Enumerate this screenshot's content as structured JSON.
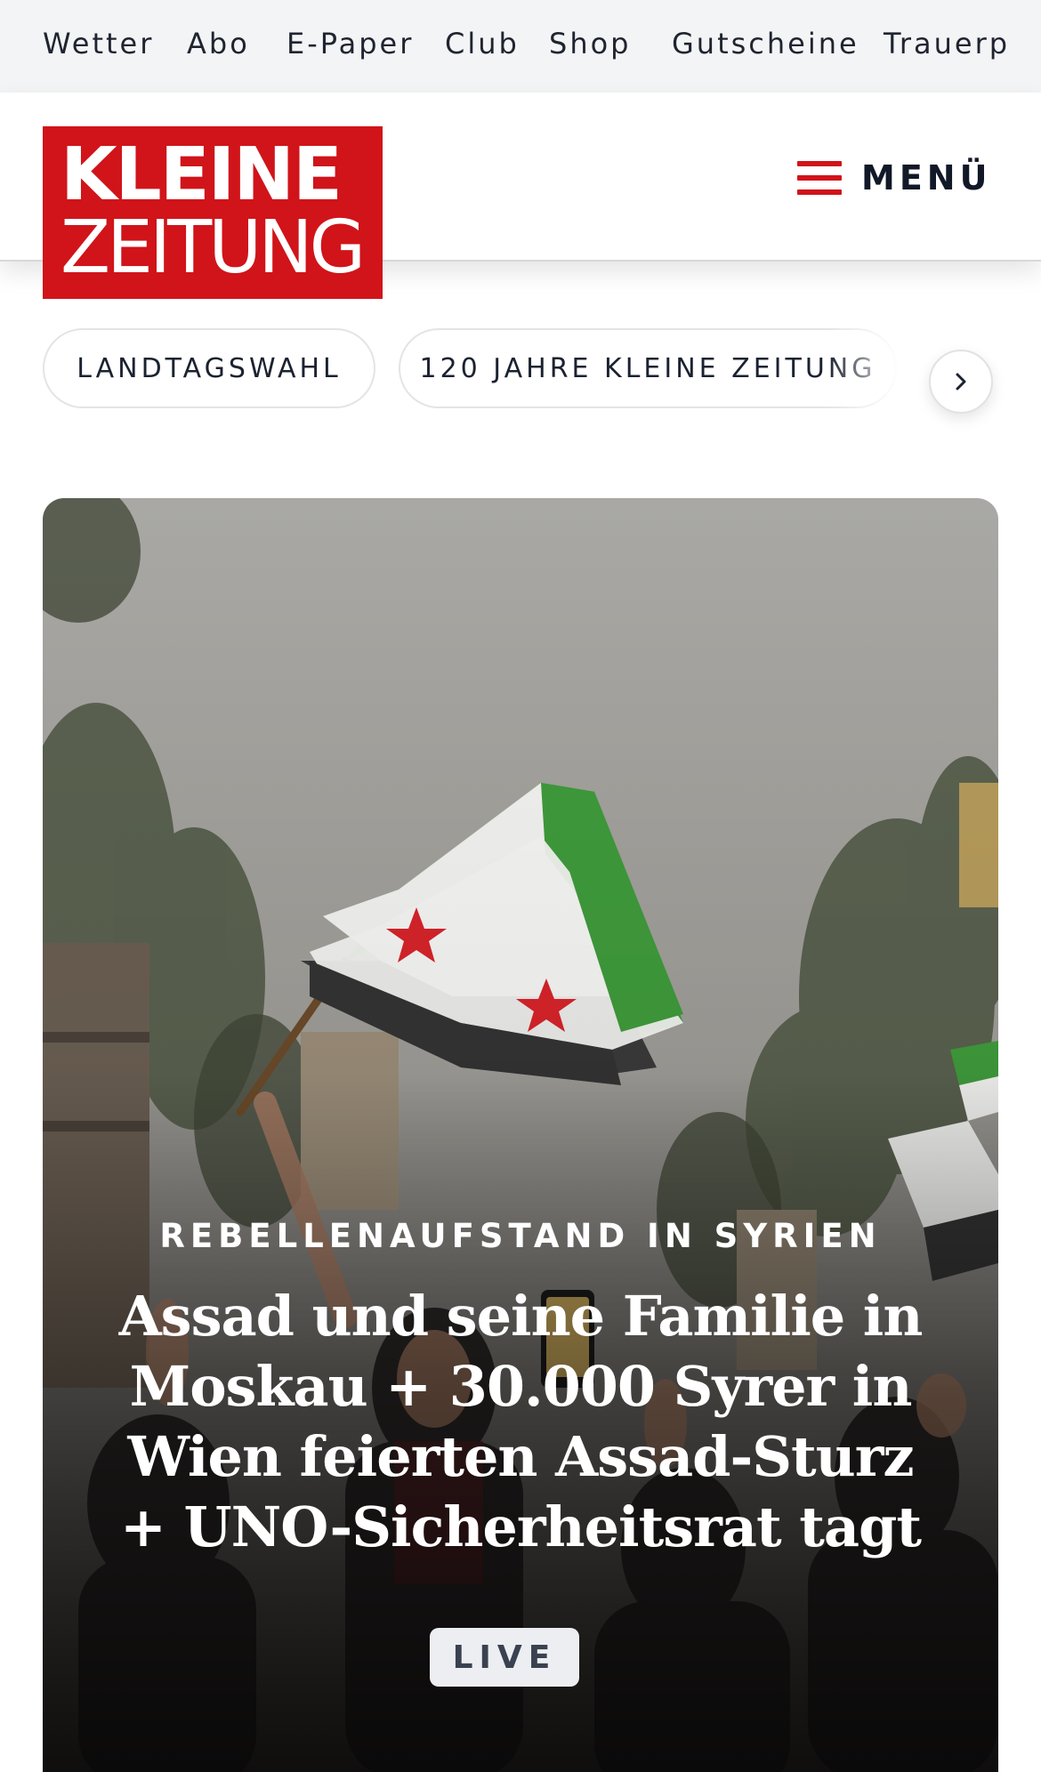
{
  "topnav": {
    "items": [
      "Wetter",
      "Abo",
      "E-Paper",
      "Club",
      "Shop",
      "Gutscheine",
      "Trauerp"
    ]
  },
  "header": {
    "logo_line1": "KLEINE",
    "logo_line2": "ZEITUNG",
    "menu_label": "MENÜ"
  },
  "topics": {
    "pills": [
      "LANDTAGSWAHL",
      "120 JAHRE KLEINE ZEITUNG"
    ]
  },
  "hero": {
    "kicker": "REBELLENAUFSTAND IN SYRIEN",
    "headline": "Assad und seine Familie in Moskau + 30.000 Syrer in Wien feierten Assad-Sturz + UNO-Sicherheitsrat tagt",
    "badge": "LIVE"
  },
  "colors": {
    "brand_red": "#d0141a",
    "topnav_bg": "#f3f4f5",
    "flag_green": "#3f9a3b",
    "flag_star": "#d5232a"
  },
  "icons": {
    "menu": "hamburger-icon",
    "scroll": "chevron-right-icon"
  }
}
